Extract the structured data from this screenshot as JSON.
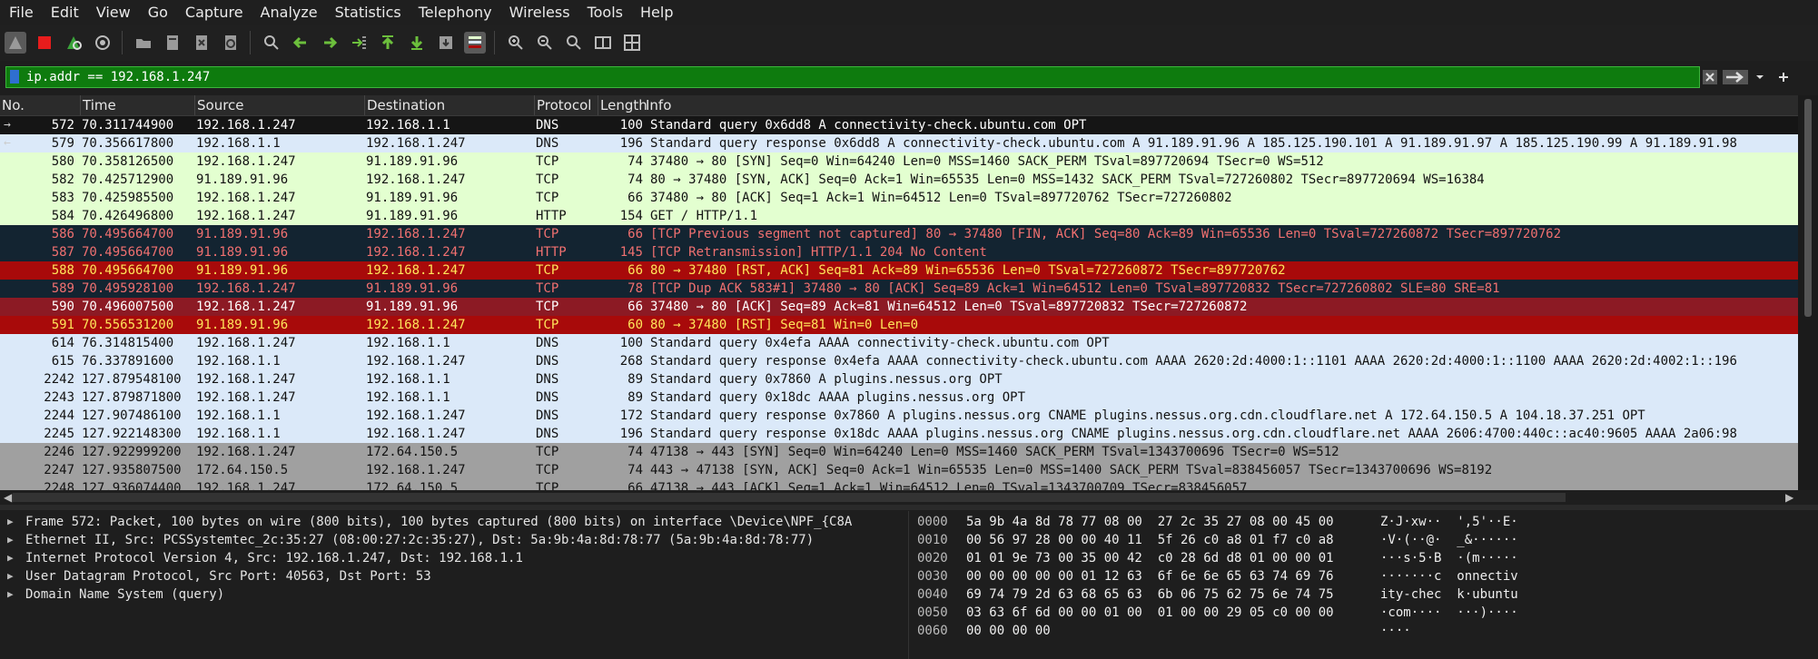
{
  "menu": [
    "File",
    "Edit",
    "View",
    "Go",
    "Capture",
    "Analyze",
    "Statistics",
    "Telephony",
    "Wireless",
    "Tools",
    "Help"
  ],
  "filter": {
    "value": "ip.addr == 192.168.1.247"
  },
  "columns": [
    "No.",
    "Time",
    "Source",
    "Destination",
    "Protocol",
    "Length",
    "Info"
  ],
  "packets": [
    {
      "no": "572",
      "time": "70.311744900",
      "src": "192.168.1.247",
      "dst": "192.168.1.1",
      "proto": "DNS",
      "len": "100",
      "info": "Standard query 0x6dd8 A connectivity-check.ubuntu.com OPT",
      "bg": "#151515",
      "fg": "#ffffff",
      "rel": "→"
    },
    {
      "no": "579",
      "time": "70.356617800",
      "src": "192.168.1.1",
      "dst": "192.168.1.247",
      "proto": "DNS",
      "len": "196",
      "info": "Standard query response 0x6dd8 A connectivity-check.ubuntu.com A 91.189.91.96 A 185.125.190.101 A 91.189.91.97 A 185.125.190.99 A 91.189.91.98",
      "bg": "#dbe9f9",
      "fg": "#121212",
      "rel": "←"
    },
    {
      "no": "580",
      "time": "70.358126500",
      "src": "192.168.1.247",
      "dst": "91.189.91.96",
      "proto": "TCP",
      "len": "74",
      "info": "37480 → 80 [SYN] Seq=0 Win=64240 Len=0 MSS=1460 SACK_PERM TSval=897720694 TSecr=0 WS=512",
      "bg": "#e3ffd0",
      "fg": "#121212",
      "rel": ""
    },
    {
      "no": "582",
      "time": "70.425712900",
      "src": "91.189.91.96",
      "dst": "192.168.1.247",
      "proto": "TCP",
      "len": "74",
      "info": "80 → 37480 [SYN, ACK] Seq=0 Ack=1 Win=65535 Len=0 MSS=1432 SACK_PERM TSval=727260802 TSecr=897720694 WS=16384",
      "bg": "#e3ffd0",
      "fg": "#121212",
      "rel": ""
    },
    {
      "no": "583",
      "time": "70.425985500",
      "src": "192.168.1.247",
      "dst": "91.189.91.96",
      "proto": "TCP",
      "len": "66",
      "info": "37480 → 80 [ACK] Seq=1 Ack=1 Win=64512 Len=0 TSval=897720762 TSecr=727260802",
      "bg": "#e3ffd0",
      "fg": "#121212",
      "rel": ""
    },
    {
      "no": "584",
      "time": "70.426496800",
      "src": "192.168.1.247",
      "dst": "91.189.91.96",
      "proto": "HTTP",
      "len": "154",
      "info": "GET / HTTP/1.1",
      "bg": "#e3ffd0",
      "fg": "#121212",
      "rel": ""
    },
    {
      "no": "586",
      "time": "70.495664700",
      "src": "91.189.91.96",
      "dst": "192.168.1.247",
      "proto": "TCP",
      "len": "66",
      "info": "[TCP Previous segment not captured] 80 → 37480 [FIN, ACK] Seq=80 Ack=89 Win=65536 Len=0 TSval=727260872 TSecr=897720762",
      "bg": "#132431",
      "fg": "#f07070",
      "rel": ""
    },
    {
      "no": "587",
      "time": "70.495664700",
      "src": "91.189.91.96",
      "dst": "192.168.1.247",
      "proto": "HTTP",
      "len": "145",
      "info": "[TCP Retransmission] HTTP/1.1 204 No Content",
      "bg": "#132431",
      "fg": "#f07070",
      "rel": ""
    },
    {
      "no": "588",
      "time": "70.495664700",
      "src": "91.189.91.96",
      "dst": "192.168.1.247",
      "proto": "TCP",
      "len": "66",
      "info": "80 → 37480 [RST, ACK] Seq=81 Ack=89 Win=65536 Len=0 TSval=727260872 TSecr=897720762",
      "bg": "#a80a0a",
      "fg": "#ffe55a",
      "rel": ""
    },
    {
      "no": "589",
      "time": "70.495928100",
      "src": "192.168.1.247",
      "dst": "91.189.91.96",
      "proto": "TCP",
      "len": "78",
      "info": "[TCP Dup ACK 583#1] 37480 → 80 [ACK] Seq=89 Ack=1 Win=64512 Len=0 TSval=897720832 TSecr=727260802 SLE=80 SRE=81",
      "bg": "#132431",
      "fg": "#f07070",
      "rel": ""
    },
    {
      "no": "590",
      "time": "70.496007500",
      "src": "192.168.1.247",
      "dst": "91.189.91.96",
      "proto": "TCP",
      "len": "66",
      "info": "37480 → 80 [ACK] Seq=89 Ack=81 Win=64512 Len=0 TSval=897720832 TSecr=727260872",
      "bg": "#8c1a24",
      "fg": "#ffffff",
      "rel": ""
    },
    {
      "no": "591",
      "time": "70.556531200",
      "src": "91.189.91.96",
      "dst": "192.168.1.247",
      "proto": "TCP",
      "len": "60",
      "info": "80 → 37480 [RST] Seq=81 Win=0 Len=0",
      "bg": "#a80a0a",
      "fg": "#ffe55a",
      "rel": ""
    },
    {
      "no": "614",
      "time": "76.314815400",
      "src": "192.168.1.247",
      "dst": "192.168.1.1",
      "proto": "DNS",
      "len": "100",
      "info": "Standard query 0x4efa AAAA connectivity-check.ubuntu.com OPT",
      "bg": "#dbe9f9",
      "fg": "#121212",
      "rel": ""
    },
    {
      "no": "615",
      "time": "76.337891600",
      "src": "192.168.1.1",
      "dst": "192.168.1.247",
      "proto": "DNS",
      "len": "268",
      "info": "Standard query response 0x4efa AAAA connectivity-check.ubuntu.com AAAA 2620:2d:4000:1::1101 AAAA 2620:2d:4000:1::1100 AAAA 2620:2d:4002:1::196",
      "bg": "#dbe9f9",
      "fg": "#121212",
      "rel": ""
    },
    {
      "no": "2242",
      "time": "127.879548100",
      "src": "192.168.1.247",
      "dst": "192.168.1.1",
      "proto": "DNS",
      "len": "89",
      "info": "Standard query 0x7860 A plugins.nessus.org OPT",
      "bg": "#dbe9f9",
      "fg": "#121212",
      "rel": ""
    },
    {
      "no": "2243",
      "time": "127.879871800",
      "src": "192.168.1.247",
      "dst": "192.168.1.1",
      "proto": "DNS",
      "len": "89",
      "info": "Standard query 0x18dc AAAA plugins.nessus.org OPT",
      "bg": "#dbe9f9",
      "fg": "#121212",
      "rel": ""
    },
    {
      "no": "2244",
      "time": "127.907486100",
      "src": "192.168.1.1",
      "dst": "192.168.1.247",
      "proto": "DNS",
      "len": "172",
      "info": "Standard query response 0x7860 A plugins.nessus.org CNAME plugins.nessus.org.cdn.cloudflare.net A 172.64.150.5 A 104.18.37.251 OPT",
      "bg": "#dbe9f9",
      "fg": "#121212",
      "rel": ""
    },
    {
      "no": "2245",
      "time": "127.922148300",
      "src": "192.168.1.1",
      "dst": "192.168.1.247",
      "proto": "DNS",
      "len": "196",
      "info": "Standard query response 0x18dc AAAA plugins.nessus.org CNAME plugins.nessus.org.cdn.cloudflare.net AAAA 2606:4700:440c::ac40:9605 AAAA 2a06:98",
      "bg": "#dbe9f9",
      "fg": "#121212",
      "rel": ""
    },
    {
      "no": "2246",
      "time": "127.922999200",
      "src": "192.168.1.247",
      "dst": "172.64.150.5",
      "proto": "TCP",
      "len": "74",
      "info": "47138 → 443 [SYN] Seq=0 Win=64240 Len=0 MSS=1460 SACK_PERM TSval=1343700696 TSecr=0 WS=512",
      "bg": "#a0a0a0",
      "fg": "#121212",
      "rel": ""
    },
    {
      "no": "2247",
      "time": "127.935807500",
      "src": "172.64.150.5",
      "dst": "192.168.1.247",
      "proto": "TCP",
      "len": "74",
      "info": "443 → 47138 [SYN, ACK] Seq=0 Ack=1 Win=65535 Len=0 MSS=1400 SACK_PERM TSval=838456057 TSecr=1343700696 WS=8192",
      "bg": "#a0a0a0",
      "fg": "#121212",
      "rel": ""
    },
    {
      "no": "2248",
      "time": "127.936074400",
      "src": "192.168.1.247",
      "dst": "172.64.150.5",
      "proto": "TCP",
      "len": "66",
      "info": "47138 → 443 [ACK] Seq=1 Ack=1 Win=64512 Len=0 TSval=1343700709 TSecr=838456057",
      "bg": "#a0a0a0",
      "fg": "#121212",
      "rel": ""
    }
  ],
  "details": [
    "Frame 572: Packet, 100 bytes on wire (800 bits), 100 bytes captured (800 bits) on interface \\Device\\NPF_{C8A",
    "Ethernet II, Src: PCSSystemtec_2c:35:27 (08:00:27:2c:35:27), Dst: 5a:9b:4a:8d:78:77 (5a:9b:4a:8d:78:77)",
    "Internet Protocol Version 4, Src: 192.168.1.247, Dst: 192.168.1.1",
    "User Datagram Protocol, Src Port: 40563, Dst Port: 53",
    "Domain Name System (query)"
  ],
  "bytes": [
    {
      "off": "0000",
      "hex": "5a 9b 4a 8d 78 77 08 00  27 2c 35 27 08 00 45 00",
      "asc": "Z·J·xw··  ',5'··E·"
    },
    {
      "off": "0010",
      "hex": "00 56 97 28 00 00 40 11  5f 26 c0 a8 01 f7 c0 a8",
      "asc": "·V·(··@·  _&······"
    },
    {
      "off": "0020",
      "hex": "01 01 9e 73 00 35 00 42  c0 28 6d d8 01 00 00 01",
      "asc": "···s·5·B  ·(m·····"
    },
    {
      "off": "0030",
      "hex": "00 00 00 00 00 01 12 63  6f 6e 6e 65 63 74 69 76",
      "asc": "·······c  onnectiv"
    },
    {
      "off": "0040",
      "hex": "69 74 79 2d 63 68 65 63  6b 06 75 62 75 6e 74 75",
      "asc": "ity-chec  k·ubuntu"
    },
    {
      "off": "0050",
      "hex": "03 63 6f 6d 00 00 01 00  01 00 00 29 05 c0 00 00",
      "asc": "·com····  ···)····"
    },
    {
      "off": "0060",
      "hex": "00 00 00 00",
      "asc": "····"
    }
  ],
  "colors": {
    "filter_ok": "#0e7b0e",
    "selected_row": "#151515"
  }
}
